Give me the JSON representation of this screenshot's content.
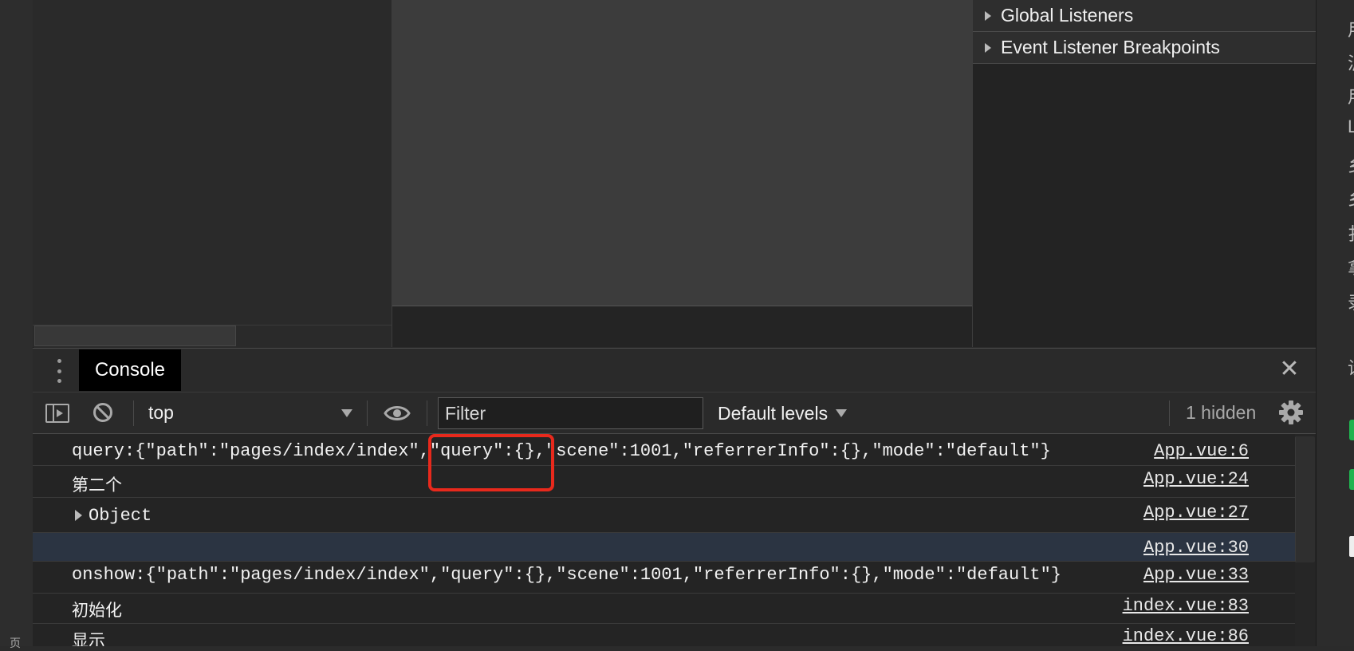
{
  "left_strip": {
    "partial_text": "页"
  },
  "right_panel": {
    "sections": [
      {
        "label": "Global Listeners"
      },
      {
        "label": "Event Listener Breakpoints"
      }
    ]
  },
  "right_strip": {
    "glyphs": [
      "用",
      "泸",
      "用",
      "L",
      "乡",
      "乡",
      "扌",
      "拿",
      "录",
      "设"
    ]
  },
  "drawer": {
    "tab_label": "Console",
    "close_label": "✕"
  },
  "toolbar": {
    "context_value": "top",
    "filter_placeholder": "Filter",
    "levels_label": "Default levels",
    "hidden_count": "1 hidden"
  },
  "console_messages": [
    {
      "text": "query:{\"path\":\"pages/index/index\",\"query\":{},\"scene\":1001,\"referrerInfo\":{},\"mode\":\"default\"}",
      "source": "App.vue:6"
    },
    {
      "text": "第二个",
      "source": "App.vue:24"
    },
    {
      "text": "Object",
      "source": "App.vue:27"
    },
    {
      "text": "",
      "source": "App.vue:30"
    },
    {
      "text": "onshow:{\"path\":\"pages/index/index\",\"query\":{},\"scene\":1001,\"referrerInfo\":{},\"mode\":\"default\"}",
      "source": "App.vue:33"
    },
    {
      "text": "初始化",
      "source": "index.vue:83"
    },
    {
      "text": "显示",
      "source": "index.vue:86"
    }
  ],
  "colors": {
    "highlight": "#e8291c",
    "accent_green": "#1fb34f",
    "selected_row": "#2b3442"
  }
}
